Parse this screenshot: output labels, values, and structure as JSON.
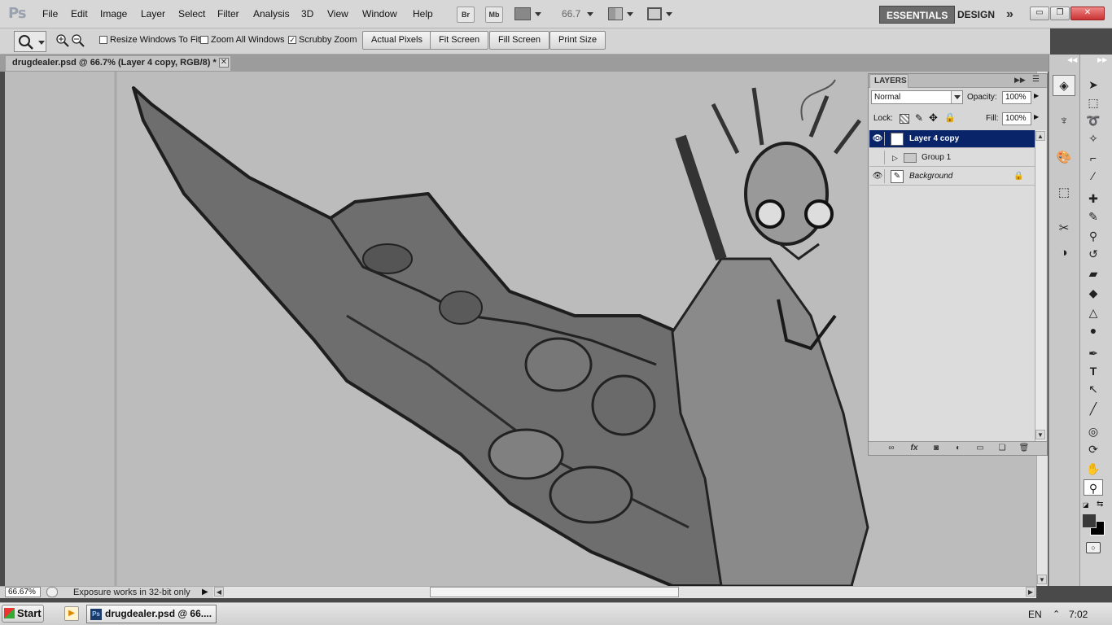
{
  "app": {
    "logo": "Ps",
    "menu": [
      "File",
      "Edit",
      "Image",
      "Layer",
      "Select",
      "Filter",
      "Analysis",
      "3D",
      "View",
      "Window",
      "Help"
    ],
    "toolbar_icons": {
      "bridge": "Br",
      "minibridge": "Mb"
    },
    "zoom_value": "66.7",
    "workspaces": {
      "active": "ESSENTIALS",
      "other": "DESIGN",
      "more": "»"
    },
    "window_controls": {
      "minimize": "▭",
      "restore": "❐",
      "close": "✕"
    }
  },
  "options_bar": {
    "checks": [
      {
        "label": "Resize Windows To Fit",
        "checked": false
      },
      {
        "label": "Zoom All Windows",
        "checked": false
      },
      {
        "label": "Scrubby Zoom",
        "checked": true
      }
    ],
    "buttons": [
      "Actual Pixels",
      "Fit Screen",
      "Fill Screen",
      "Print Size"
    ]
  },
  "document": {
    "tab_title": "drugdealer.psd @ 66.7% (Layer 4 copy, RGB/8) *",
    "close": "✕"
  },
  "status": {
    "zoom": "66.67%",
    "message": "Exposure works in 32-bit only"
  },
  "layers_panel": {
    "title": "LAYERS",
    "blend_mode": "Normal",
    "opacity_label": "Opacity:",
    "opacity_value": "100%",
    "lock_label": "Lock:",
    "fill_label": "Fill:",
    "fill_value": "100%",
    "layers": [
      {
        "name": "Layer 4 copy",
        "visible": true,
        "selected": true,
        "type": "layer"
      },
      {
        "name": "Group 1",
        "visible": false,
        "selected": false,
        "type": "group"
      },
      {
        "name": "Background",
        "visible": true,
        "selected": false,
        "type": "background",
        "locked": true
      }
    ]
  },
  "taskbar": {
    "start": "Start",
    "task": "drugdealer.psd @ 66....",
    "language": "EN",
    "time": "7:02"
  },
  "colors": {
    "selected_layer": "#0a246a",
    "canvas": "#bcbcbc",
    "active_workspace": "#6b6b6b"
  }
}
